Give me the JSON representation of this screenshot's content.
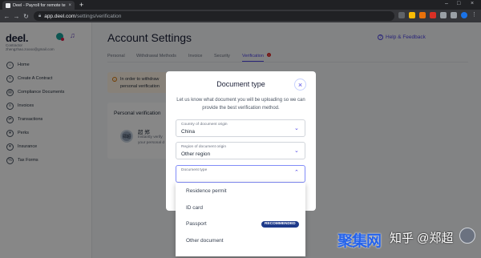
{
  "browser": {
    "tab_title": "Deel - Payroll for remote team",
    "tab_close": "×",
    "new_tab": "+",
    "url_host": "app.deel.com",
    "url_path": "/settings/verification",
    "window_min": "–",
    "window_max": "□",
    "window_close": "×"
  },
  "sidebar": {
    "logo": "deel.",
    "role": "Contractor",
    "email": "zhengzhao.zoooo@gmail.com",
    "items": [
      {
        "label": "Home",
        "icon": "home-icon"
      },
      {
        "label": "Create A Contract",
        "icon": "plus-circle-icon"
      },
      {
        "label": "Compliance Documents",
        "icon": "document-icon"
      },
      {
        "label": "Invoices",
        "icon": "invoice-icon"
      },
      {
        "label": "Transactions",
        "icon": "transactions-icon"
      },
      {
        "label": "Perks",
        "icon": "perks-icon"
      },
      {
        "label": "Insurance",
        "icon": "insurance-icon"
      },
      {
        "label": "Tax Forms",
        "icon": "tax-icon"
      }
    ]
  },
  "main": {
    "title": "Account Settings",
    "help_label": "Help & Feedback",
    "tabs": [
      {
        "label": "Personal"
      },
      {
        "label": "Withdrawal Methods"
      },
      {
        "label": "Invoice"
      },
      {
        "label": "Security"
      },
      {
        "label": "Verification",
        "active": true,
        "badge": "!"
      }
    ],
    "notice": "In order to withdraw ... personal verification",
    "notice_line1": "In order to withdraw",
    "notice_line2": "personal verification",
    "pv": {
      "title": "Personal verification",
      "avatar_text": "郑超",
      "name": "超 郑",
      "sub1": "Instantly verify",
      "sub2": "your personal d"
    }
  },
  "modal": {
    "title": "Document type",
    "close": "×",
    "desc_line1": "Let us know what document you will be uploading so we can",
    "desc_line2": "provide the best verification method.",
    "fields": [
      {
        "label": "Country of document origin",
        "value": "China"
      },
      {
        "label": "Region of document origin",
        "value": "Other region"
      },
      {
        "label": "Document type",
        "value": ""
      }
    ],
    "options": [
      {
        "label": "Residence permit"
      },
      {
        "label": "ID card"
      },
      {
        "label": "Passport",
        "badge": "RECOMMENDED"
      },
      {
        "label": "Other document"
      }
    ]
  },
  "watermark": {
    "logo": "聚集网",
    "text": "知乎 @郑超"
  },
  "colors": {
    "accent": "#4f46e5",
    "badge": "#1e3a8a",
    "danger": "#dc2626",
    "notice_bg": "#fff4e5"
  }
}
